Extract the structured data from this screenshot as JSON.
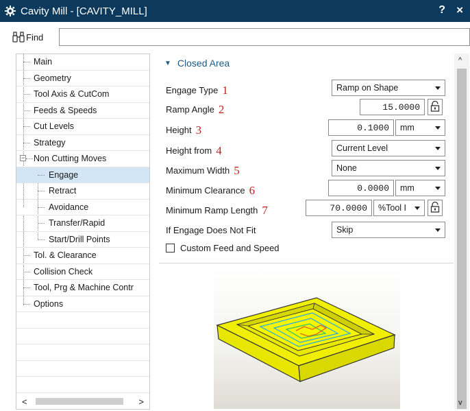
{
  "window": {
    "title": "Cavity Mill - [CAVITY_MILL]",
    "help_label": "?",
    "close_label": "×"
  },
  "findbar": {
    "label": "Find",
    "value": ""
  },
  "tree": {
    "items": [
      {
        "label": "Main",
        "level": 0
      },
      {
        "label": "Geometry",
        "level": 0
      },
      {
        "label": "Tool Axis & CutCom",
        "level": 0
      },
      {
        "label": "Feeds & Speeds",
        "level": 0
      },
      {
        "label": "Cut Levels",
        "level": 0
      },
      {
        "label": "Strategy",
        "level": 0
      },
      {
        "label": "Non Cutting Moves",
        "level": 0,
        "expanded": true
      },
      {
        "label": "Engage",
        "level": 1,
        "selected": true
      },
      {
        "label": "Retract",
        "level": 1
      },
      {
        "label": "Avoidance",
        "level": 1
      },
      {
        "label": "Transfer/Rapid",
        "level": 1
      },
      {
        "label": "Start/Drill Points",
        "level": 1
      },
      {
        "label": "Tol. & Clearance",
        "level": 0
      },
      {
        "label": "Collision Check",
        "level": 0
      },
      {
        "label": "Tool, Prg & Machine Contr",
        "level": 0
      },
      {
        "label": "Options",
        "level": 0
      }
    ],
    "expander_symbol": "−",
    "scroll_left": "<",
    "scroll_right": ">"
  },
  "section": {
    "title": "Closed Area"
  },
  "params": {
    "engage_type": {
      "label": "Engage Type",
      "marker": "1",
      "value": "Ramp on Shape"
    },
    "ramp_angle": {
      "label": "Ramp Angle",
      "marker": "2",
      "value": "15.0000"
    },
    "height": {
      "label": "Height",
      "marker": "3",
      "value": "0.1000",
      "unit": "mm"
    },
    "height_from": {
      "label": "Height from",
      "marker": "4",
      "value": "Current Level"
    },
    "maximum_width": {
      "label": "Maximum Width",
      "marker": "5",
      "value": "None"
    },
    "minimum_clearance": {
      "label": "Minimum Clearance",
      "marker": "6",
      "value": "0.0000",
      "unit": "mm"
    },
    "minimum_ramp_length": {
      "label": "Minimum Ramp Length",
      "marker": "7",
      "value": "70.0000",
      "unit": "%Tool I"
    },
    "if_engage_not_fit": {
      "label": "If Engage Does Not Fit",
      "value": "Skip"
    },
    "custom_feed": {
      "label": "Custom Feed and Speed",
      "checked": false
    }
  },
  "colors": {
    "titlebar": "#0d3a5c",
    "accent": "#1e5a86",
    "marker": "#c42222",
    "part_yellow": "#f2f200"
  },
  "preview": {
    "icon": "cavity-part-preview"
  }
}
